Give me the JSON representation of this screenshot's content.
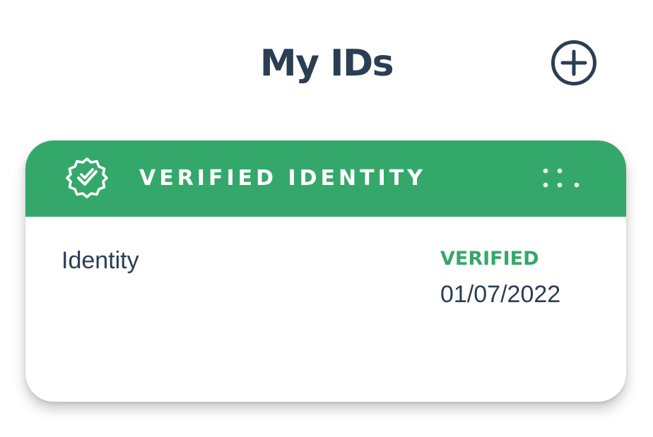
{
  "header": {
    "title": "My IDs",
    "add_icon": "plus-circle-icon"
  },
  "card": {
    "header_title": "VERIFIED IDENTITY",
    "header_icon": "verified-badge-icon",
    "menu_icon": "more-dots-icon",
    "id_type": "Identity",
    "status": "VERIFIED",
    "date": "01/07/2022"
  },
  "colors": {
    "accent_green": "#34a86a",
    "text_dark": "#2b3e54",
    "card_background": "#ffffff"
  }
}
